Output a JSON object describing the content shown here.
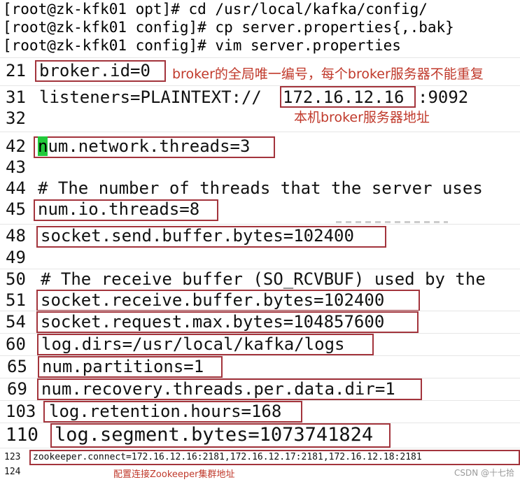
{
  "terminal": {
    "commands": [
      "[root@zk-kfk01 opt]# cd /usr/local/kafka/config/",
      "[root@zk-kfk01 config]# cp server.properties{,.bak}",
      "[root@zk-kfk01 config]# vim server.properties"
    ]
  },
  "editor": {
    "lines": [
      {
        "num": "21",
        "text": "broker.id=0"
      },
      {
        "num": "31",
        "prefix": "listeners=PLAINTEXT://",
        "ip": "172.16.12.16",
        "suffix": ":9092"
      },
      {
        "num": "32"
      },
      {
        "num": "42",
        "cursor_char": "n",
        "text": "um.network.threads=3"
      },
      {
        "num": "43"
      },
      {
        "num": "44",
        "text": "# The number of threads that the server uses"
      },
      {
        "num": "45",
        "text": "num.io.threads=8"
      },
      {
        "num": "48",
        "text": "socket.send.buffer.bytes=102400"
      },
      {
        "num": "49"
      },
      {
        "num": "50",
        "text": "# The receive buffer (SO_RCVBUF) used by the"
      },
      {
        "num": "51",
        "text": "socket.receive.buffer.bytes=102400"
      },
      {
        "num": "54",
        "text": "socket.request.max.bytes=104857600"
      },
      {
        "num": "60",
        "text": "log.dirs=/usr/local/kafka/logs"
      },
      {
        "num": "65",
        "text": "num.partitions=1"
      },
      {
        "num": "69",
        "text": "num.recovery.threads.per.data.dir=1"
      },
      {
        "num": "103",
        "text": "log.retention.hours=168"
      },
      {
        "num": "110",
        "text": "log.segment.bytes=1073741824"
      },
      {
        "num": "123",
        "text": "zookeeper.connect=172.16.12.16:2181,172.16.12.17:2181,172.16.12.18:2181"
      },
      {
        "num": "124"
      }
    ]
  },
  "annotations": {
    "broker_id": "broker的全局唯一编号，每个broker服务器不能重复",
    "listener_ip": "本机broker服务器地址",
    "zookeeper": "配置连接Zookeeper集群地址"
  },
  "watermark": "CSDN @十七拾",
  "colors": {
    "highlight_box": "#a3343c",
    "annotation_text": "#c0392b",
    "cursor": "#22c93a"
  }
}
